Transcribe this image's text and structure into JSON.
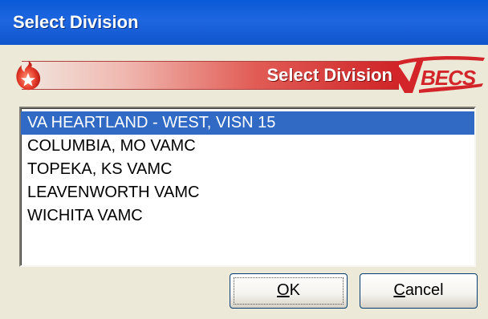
{
  "window": {
    "title": "Select Division"
  },
  "banner": {
    "title": "Select Division",
    "logo_text": "VBECS",
    "icon": "flame-star-icon",
    "colors": {
      "accent": "#cf2427",
      "strip_start": "#f1e7df"
    }
  },
  "list": {
    "items": [
      "VA HEARTLAND - WEST, VISN 15",
      "COLUMBIA, MO VAMC",
      "TOPEKA, KS VAMC",
      "LEAVENWORTH VAMC",
      "WICHITA VAMC"
    ],
    "selected_index": 0,
    "selection_color": "#316ac5"
  },
  "buttons": {
    "ok": {
      "accel": "O",
      "rest": "K"
    },
    "cancel": {
      "accel": "C",
      "rest": "ancel"
    }
  },
  "colors": {
    "titlebar": "#0a59d6",
    "face": "#ece9d8"
  }
}
